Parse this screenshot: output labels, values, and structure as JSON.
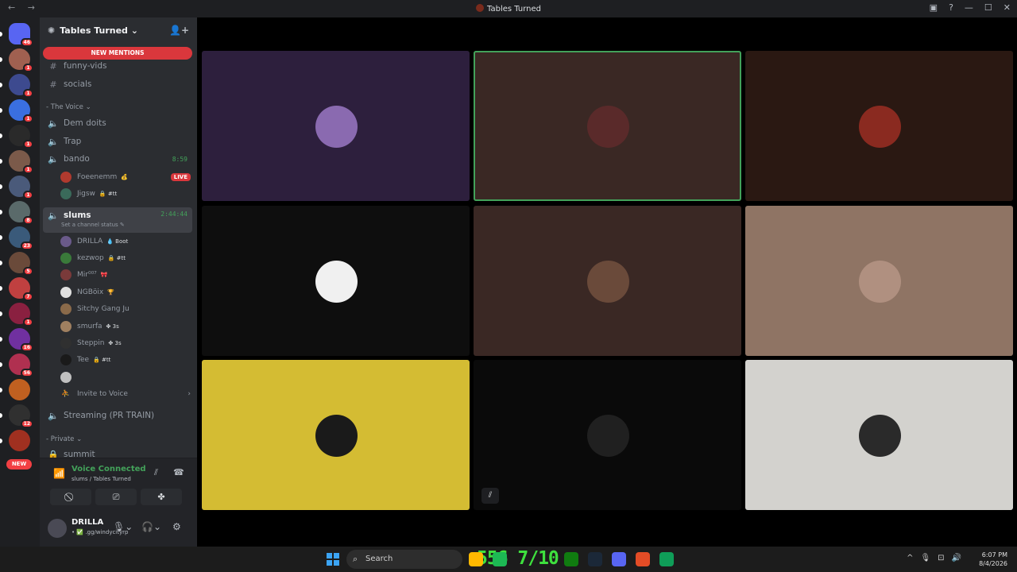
{
  "window": {
    "title": "Tables Turned",
    "nav": "← →",
    "controls": [
      "▣",
      "?",
      "—",
      "☐",
      "✕"
    ]
  },
  "guilds": [
    {
      "color": "#5865f2",
      "badge": "46",
      "icon": "discord-home-icon"
    },
    {
      "color": "#a06050",
      "badge": "1"
    },
    {
      "color": "#3d4a8f",
      "badge": "1"
    },
    {
      "color": "#3a6fe0",
      "badge": "1"
    },
    {
      "color": "#2a2a2a",
      "badge": "1"
    },
    {
      "color": "#7b5a4a",
      "badge": "1"
    },
    {
      "color": "#4a5a7a",
      "badge": "1"
    },
    {
      "color": "#5a6a6a",
      "badge": "8"
    },
    {
      "color": "#3a5a7a",
      "badge": "23"
    },
    {
      "color": "#6a4a3a",
      "badge": "5"
    },
    {
      "color": "#c04040",
      "badge": "7"
    },
    {
      "color": "#8a2040",
      "badge": "1"
    },
    {
      "color": "#7030a0",
      "badge": "16"
    },
    {
      "color": "#b03050",
      "badge": "56"
    },
    {
      "color": "#c06020",
      "badge": ""
    },
    {
      "color": "#303030",
      "badge": "12"
    },
    {
      "color": "#a03020",
      "badge": ""
    }
  ],
  "new_badge": "NEW",
  "server": {
    "name": "Tables Turned ⌄",
    "new_mentions": "NEW MENTIONS"
  },
  "channels_top": [
    "funny-vids",
    "socials"
  ],
  "category_voice": "- The Voice ⌄",
  "voice_channels": {
    "dem_doits": "Dem doits",
    "trap": "Trap",
    "bando": {
      "name": "bando",
      "time": "8:59"
    },
    "slums": {
      "name": "slums",
      "time": "2:44:44",
      "status": "Set a channel status ✎"
    },
    "streaming": "Streaming (PR TRAIN)"
  },
  "bando_users": [
    {
      "name": "Foeenemm",
      "tag": "💰",
      "live": "LIVE",
      "color": "#b03a2e"
    },
    {
      "name": "Jigsw",
      "tag": "🔒 #tt",
      "live": "",
      "color": "#3a6a5a"
    }
  ],
  "slums_users": [
    {
      "name": "DRILLA",
      "tag": "💧 Boot",
      "color": "#6a5a8a"
    },
    {
      "name": "kezwop",
      "tag": "🔒 #tt",
      "color": "#3a7a3a"
    },
    {
      "name": "Mir⁰⁰⁷",
      "tag": "🎀",
      "color": "#7a3a3a"
    },
    {
      "name": "NGBöix",
      "tag": "🏆",
      "color": "#e0e0e0"
    },
    {
      "name": "Sitchy Gang Ju",
      "tag": "",
      "color": "#8a6a4a"
    },
    {
      "name": "smurfa",
      "tag": "✤ 3s",
      "color": "#a08060"
    },
    {
      "name": "Steppin",
      "tag": "✤ 3s",
      "color": "#303030"
    },
    {
      "name": "Tee",
      "tag": "🔒 #tt",
      "color": "#1a1a1a"
    },
    {
      "name": "",
      "tag": "",
      "color": "#c0c0c0"
    }
  ],
  "invite": "Invite to Voice",
  "category_private": "- Private ⌄",
  "private_channel": "summit",
  "voice_panel": {
    "title": "Voice Connected",
    "subtitle": "slums / Tables Turned"
  },
  "user_panel": {
    "name": "DRILLA",
    "subtitle": "• ✅ .gg/windycityrp"
  },
  "tiles": [
    {
      "bg": "#2d1f3d",
      "avatar": "#8a6ab0",
      "speaking": false,
      "muted": false
    },
    {
      "bg": "#3a2824",
      "avatar": "#5a2a2a",
      "speaking": true,
      "muted": false
    },
    {
      "bg": "#2a1812",
      "avatar": "#8a2a20",
      "speaking": false,
      "muted": false
    },
    {
      "bg": "#0e0e0e",
      "avatar": "#f0f0f0",
      "speaking": false,
      "muted": false
    },
    {
      "bg": "#3a2824",
      "avatar": "#6a4a3a",
      "speaking": false,
      "muted": false
    },
    {
      "bg": "#8f7464",
      "avatar": "#b09080",
      "speaking": false,
      "muted": false
    },
    {
      "bg": "#d4bc33",
      "avatar": "#1a1a1a",
      "speaking": false,
      "muted": false
    },
    {
      "bg": "#0a0a0a",
      "avatar": "#202020",
      "speaking": false,
      "muted": true
    },
    {
      "bg": "#d3d2ce",
      "avatar": "#2a2a2a",
      "speaking": false,
      "muted": false
    }
  ],
  "taskbar": {
    "search": "Search",
    "overlay": "556 7/10",
    "apps": [
      {
        "color": "#ffb900",
        "name": "file-explorer-icon"
      },
      {
        "color": "#1db954",
        "name": "spotify-icon"
      },
      {
        "color": "#107c10",
        "name": "xbox-icon"
      },
      {
        "color": "#1b2838",
        "name": "steam-icon"
      },
      {
        "color": "#5865f2",
        "name": "discord-icon"
      },
      {
        "color": "#e34c26",
        "name": "chrome-icon"
      },
      {
        "color": "#0f9d58",
        "name": "edge-icon"
      }
    ],
    "tray": [
      "^",
      "🎙",
      "⊡",
      "🔊"
    ],
    "time": "6:07 PM",
    "date": "8/4/2026"
  }
}
